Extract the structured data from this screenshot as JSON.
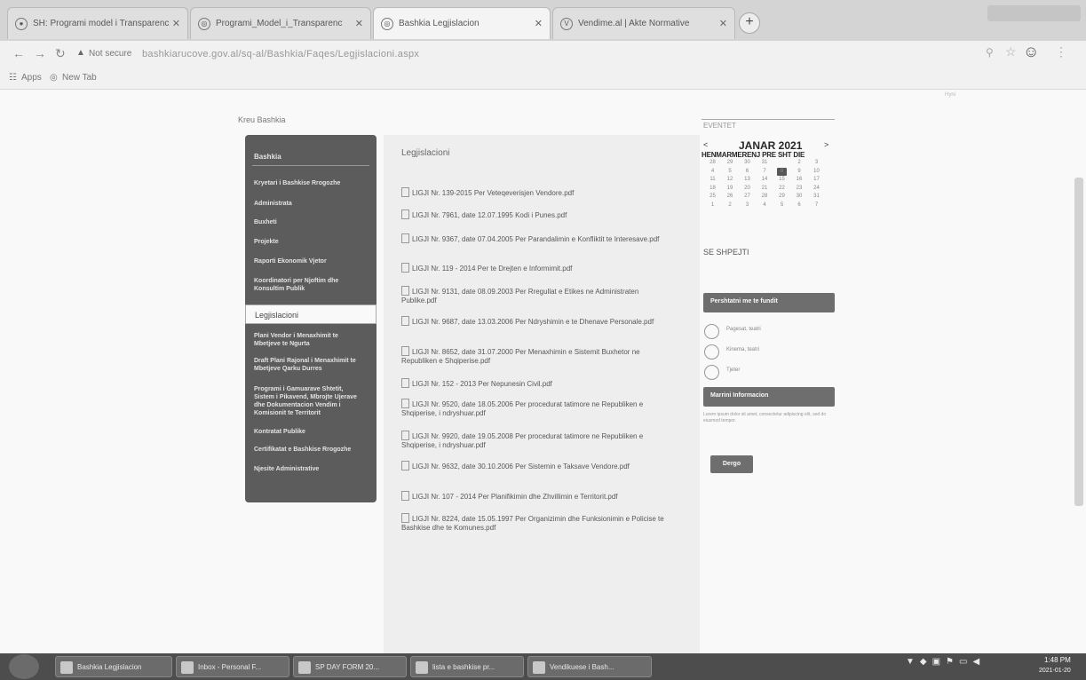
{
  "browser": {
    "tabs": [
      {
        "title": "SH: Programi model i Transparenc",
        "active": false
      },
      {
        "title": "Programi_Model_i_Transparenc",
        "active": false
      },
      {
        "title": "Bashkia Legjislacion",
        "active": true
      },
      {
        "title": "Vendime.al | Akte Normative",
        "active": false
      }
    ],
    "new_tab": "+",
    "security": "Not secure",
    "url": "bashkiarucove.gov.al/sq-al/Bashkia/Faqes/Legjislacioni.aspx",
    "bookmarks": [
      "Apps",
      "New Tab"
    ]
  },
  "page": {
    "breadcrumb": "Kreu  Bashkia",
    "sidebar": {
      "header": "Bashkia",
      "items": [
        "Kryetari i Bashkise Rrogozhe",
        "Administrata",
        "Buxheti",
        "Projekte",
        "Raporti Ekonomik Vjetor",
        "Koordinatori per Njoftim dhe Konsultim Publik",
        "Legjislacioni",
        "Plani Vendor i Menaxhimit te Mbetjeve te Ngurta",
        "Draft Plani Rajonal i Menaxhimit te Mbetjeve Qarku Durres",
        "Programi i Gamuarave Shtetit, Sistem i Pikavend, Mbrojte Ujerave dhe Dokumentacion Vendim i Komisionit te Territorit",
        "Kontratat Publike",
        "Certifikatat e Bashkise Rrogozhe",
        "Njesite Administrative"
      ],
      "active_index": 6
    },
    "content": {
      "title": "Legjislacioni",
      "documents": [
        "LIGJI Nr. 139-2015 Per Veteqeverisjen Vendore.pdf",
        "LIGJI Nr. 7961, date 12.07.1995 Kodi i Punes.pdf",
        "LIGJI Nr. 9367, date 07.04.2005 Per Parandalimin e Konfliktit te Interesave.pdf",
        "LIGJI Nr. 119 - 2014 Per te Drejten e Informimit.pdf",
        "LIGJI Nr. 9131, date 08.09.2003 Per Rregullat e Etikes ne Administraten Publike.pdf",
        "LIGJI Nr. 9687, date 13.03.2006 Per Ndryshimin e te Dhenave Personale.pdf",
        "LIGJI Nr. 8652, date 31.07.2000 Per Menaxhimin e Sistemit Buxhetor ne Republiken e Shqiperise.pdf",
        "LIGJI Nr. 152 - 2013 Per Nepunesin Civil.pdf",
        "LIGJI Nr. 9520, date 18.05.2006 Per procedurat tatimore ne Republiken e Shqiperise, i ndryshuar.pdf",
        "LIGJI Nr. 9920, date 19.05.2008 Per procedurat tatimore ne Republiken e Shqiperise, i ndryshuar.pdf",
        "LIGJI Nr. 9632, date 30.10.2006 Per Sistemin e Taksave Vendore.pdf",
        "LIGJI Nr. 107 - 2014 Per Planifikimin dhe Zhvillimin e Territorit.pdf",
        "LIGJI Nr. 8224, date 15.05.1997 Per Organizimin dhe Funksionimin e Policise te Bashkise dhe te Komunes.pdf"
      ]
    },
    "right": {
      "events_label": "EVENTET",
      "calendar": {
        "prev": "<",
        "next": ">",
        "month": "JANAR 2021",
        "weekdays": "HENMARMERENJ PRE SHT DIE",
        "weeks": [
          [
            "28",
            "29",
            "30",
            "31",
            "1",
            "2",
            "3"
          ],
          [
            "4",
            "5",
            "6",
            "7",
            "8",
            "9",
            "10"
          ],
          [
            "11",
            "12",
            "13",
            "14",
            "15",
            "16",
            "17"
          ],
          [
            "18",
            "19",
            "20",
            "21",
            "22",
            "23",
            "24"
          ],
          [
            "25",
            "26",
            "27",
            "28",
            "29",
            "30",
            "31"
          ],
          [
            "1",
            "2",
            "3",
            "4",
            "5",
            "6",
            "7"
          ]
        ],
        "today": "1"
      },
      "see_all": "SE SHPEJTI",
      "panel_title": "Pershtatni me te fundit",
      "radio_options": [
        "Pagesat, teatri",
        "Kinema, teatri",
        "Tjeter"
      ],
      "info_title": "Marrini Informacion",
      "info_text": "Lorem ipsum dolor sit amet, consectetur adipiscing elit, sed do eiusmod tempor.",
      "send_button": "Dergo",
      "topright": "Hyni"
    }
  },
  "taskbar": {
    "items": [
      "Bashkia Legjislacion",
      "Inbox - Personal F...",
      "SP DAY FORM 20...",
      "lista e bashkise pr...",
      "Vendikuese i Bash..."
    ],
    "time": "1:48 PM",
    "date": "2021-01-20"
  }
}
